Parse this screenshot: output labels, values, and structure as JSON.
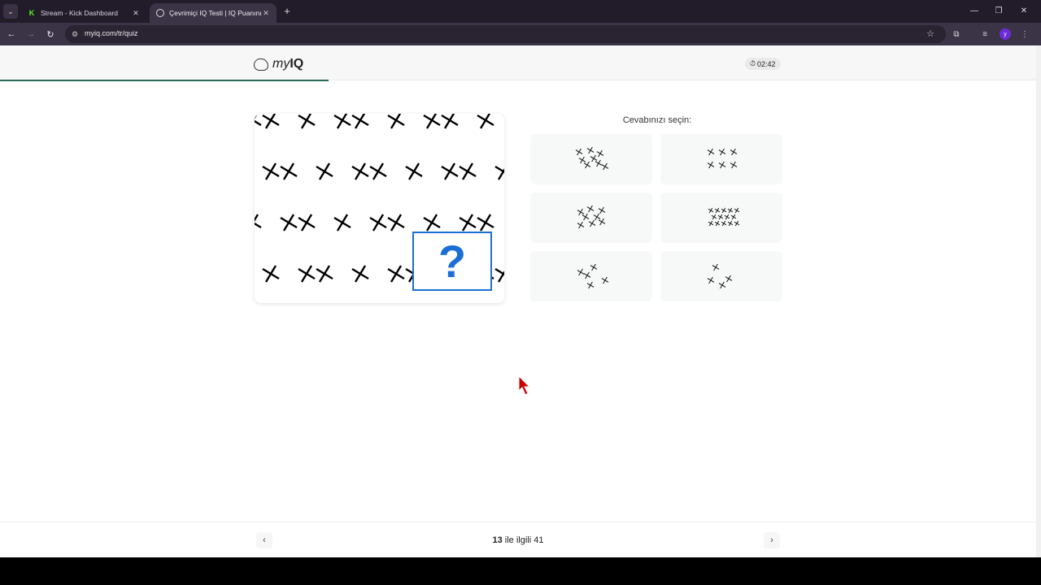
{
  "browser": {
    "tabs": [
      {
        "title": "Stream - Kick Dashboard",
        "active": false
      },
      {
        "title": "Çevrimiçi IQ Testi | IQ Puanınızı",
        "active": true
      }
    ],
    "url": "myiq.com/tr/quiz",
    "profile_initial": "y"
  },
  "site": {
    "logo_my": "my",
    "logo_iq": "IQ",
    "timer": "02:42"
  },
  "question": {
    "missing_mark": "?"
  },
  "answers": {
    "title": "Cevabınızı seçin:"
  },
  "pager": {
    "current": "13",
    "separator": " ile ilgili ",
    "total": "41"
  },
  "colors": {
    "accent": "#1a6fd6",
    "progress": "#2a6b5a",
    "tab_bg": "#221b2a",
    "toolbar_bg": "#3b3346"
  }
}
